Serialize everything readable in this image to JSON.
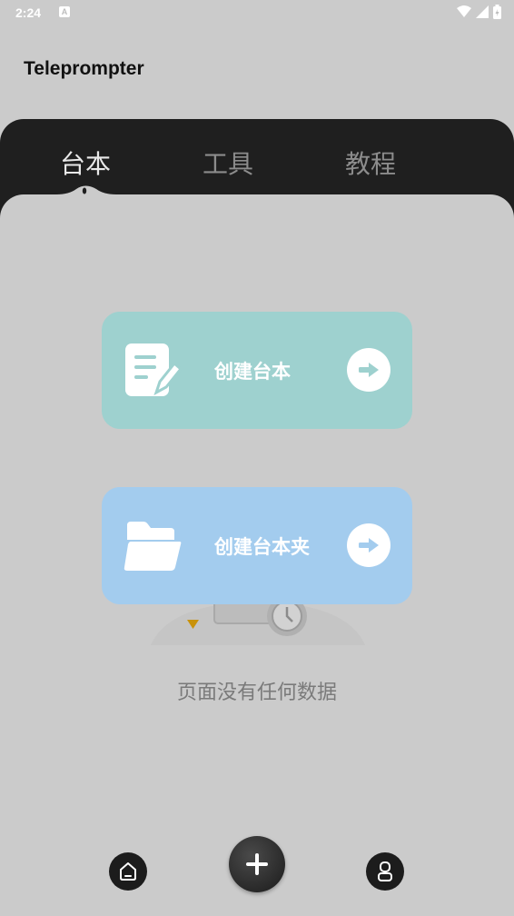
{
  "status_bar": {
    "time": "2:24",
    "icons": [
      "notification-a-icon",
      "wifi-icon",
      "signal-icon",
      "battery-icon"
    ]
  },
  "app": {
    "title": "Teleprompter"
  },
  "tabs": [
    {
      "label": "台本",
      "active": true
    },
    {
      "label": "工具",
      "active": false
    },
    {
      "label": "教程",
      "active": false
    }
  ],
  "actions": {
    "create_script": {
      "label": "创建台本",
      "icon": "document-edit-icon",
      "color": "#9ed1cf"
    },
    "create_folder": {
      "label": "创建台本夹",
      "icon": "folder-open-icon",
      "color": "#a3ccee"
    }
  },
  "empty_state": {
    "message": "页面没有任何数据"
  },
  "bottom_nav": {
    "items": [
      "home-icon",
      "add-icon",
      "user-icon"
    ]
  }
}
